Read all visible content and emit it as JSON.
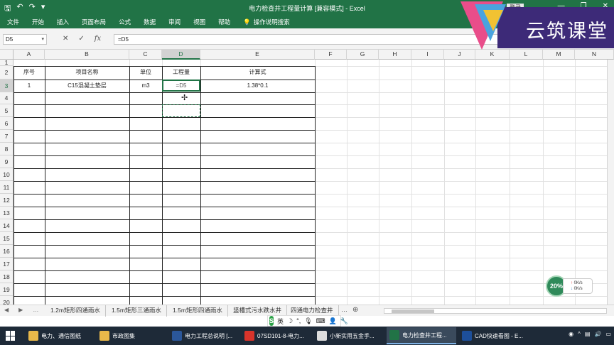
{
  "window": {
    "title": "电力检查井工程量计算 [兼容模式] - Excel",
    "login_label": "登录"
  },
  "ribbon": {
    "tabs": [
      "文件",
      "开始",
      "插入",
      "页面布局",
      "公式",
      "数据",
      "审阅",
      "视图",
      "帮助"
    ],
    "tell_me": "操作说明搜索"
  },
  "formula_bar": {
    "name_box": "D5",
    "formula": "=D5"
  },
  "brand": {
    "text": "云筑课堂"
  },
  "columns": [
    "A",
    "B",
    "C",
    "D",
    "E",
    "F",
    "G",
    "H",
    "I",
    "J",
    "K",
    "L",
    "M",
    "N"
  ],
  "rows": [
    "1",
    "2",
    "3",
    "4",
    "5",
    "6",
    "7",
    "8",
    "9",
    "10",
    "11",
    "12",
    "13",
    "14",
    "15",
    "16",
    "17",
    "18",
    "19",
    "20"
  ],
  "table": {
    "headers": [
      "序号",
      "项目名称",
      "单位",
      "工程量",
      "计算式"
    ],
    "row1": [
      "1",
      "C15混凝土垫层",
      "m3",
      "=D5",
      "1.38*0.1"
    ]
  },
  "net_widget": {
    "percent": "20%",
    "up": "0K/s",
    "down": "0K/s"
  },
  "sheets": [
    "1.2m矩形四通雨水",
    "1.5m矩形三通雨水",
    "1.5m矩形四通雨水",
    "竖槽式污水跌水井",
    "四通电力检查井"
  ],
  "ime": {
    "lang": "英"
  },
  "taskbar": {
    "items": [
      "电力、通信图纸",
      "市政图集",
      "电力工程总说明 [...",
      "07SD101-8-电力...",
      "小新实用五金手...",
      "电力检查井工程...",
      "CAD快速看图 - E..."
    ]
  }
}
